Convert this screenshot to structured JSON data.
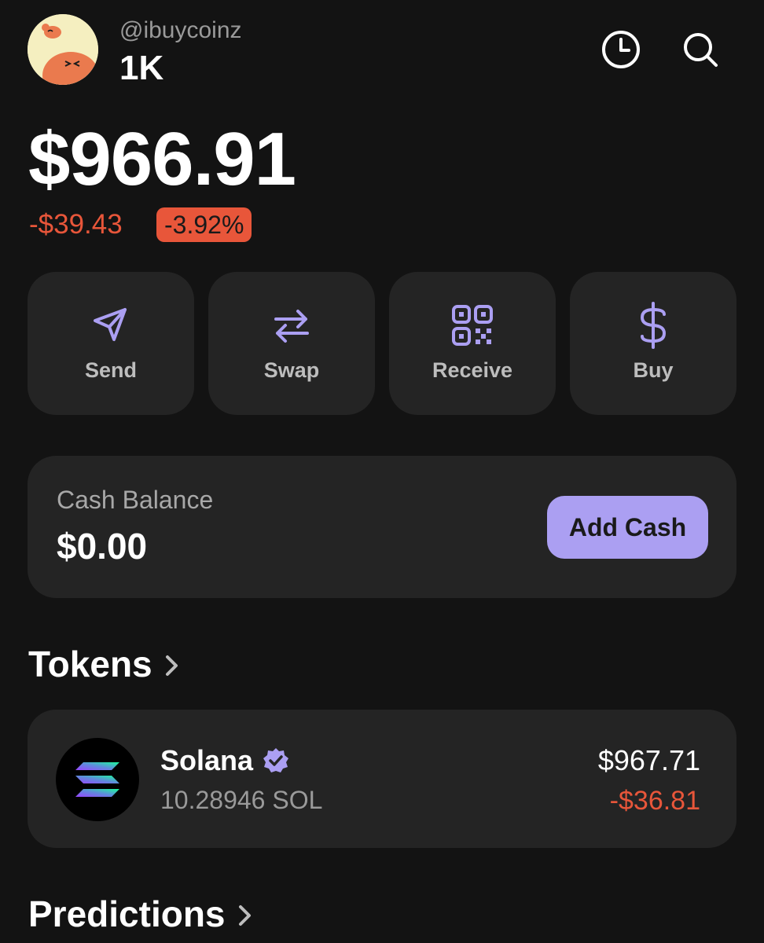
{
  "header": {
    "handle": "@ibuycoinz",
    "account_name": "1K",
    "history_icon": "clock-icon",
    "search_icon": "search-icon"
  },
  "portfolio": {
    "balance": "$966.91",
    "change_value": "-$39.43",
    "change_percent": "-3.92%"
  },
  "actions": [
    {
      "label": "Send",
      "icon": "send-icon"
    },
    {
      "label": "Swap",
      "icon": "swap-icon"
    },
    {
      "label": "Receive",
      "icon": "qr-code-icon"
    },
    {
      "label": "Buy",
      "icon": "dollar-icon"
    }
  ],
  "cash": {
    "label": "Cash Balance",
    "value": "$0.00",
    "button_label": "Add Cash"
  },
  "tokens_section": {
    "title": "Tokens",
    "items": [
      {
        "name": "Solana",
        "amount": "10.28946 SOL",
        "value": "$967.71",
        "change": "-$36.81",
        "verified": true
      }
    ]
  },
  "predictions_section": {
    "title": "Predictions"
  },
  "colors": {
    "background": "#131313",
    "card": "#242424",
    "accent": "#ab9ff2",
    "negative": "#e8563a",
    "muted": "#9a9a9a"
  }
}
